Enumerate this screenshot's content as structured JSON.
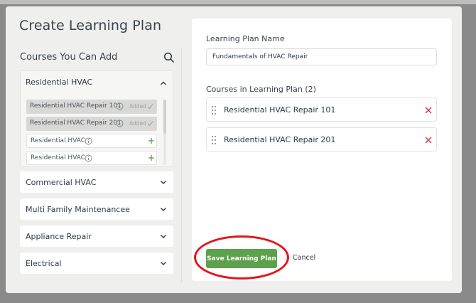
{
  "modal": {
    "title": "Create Learning Plan",
    "left_heading": "Courses You Can Add"
  },
  "course_groups": [
    {
      "label": "Residential HVAC",
      "expanded": true,
      "courses": [
        {
          "name": "Residential HVAC Repair 101",
          "status": "Added"
        },
        {
          "name": "Residential HVAC Repair 201",
          "status": "Added"
        },
        {
          "name": "Residential HVAC",
          "status": "available"
        },
        {
          "name": "Residential HVAC",
          "status": "available"
        }
      ]
    },
    {
      "label": "Commercial HVAC",
      "expanded": false
    },
    {
      "label": "Multi Family Maintenancee",
      "expanded": false
    },
    {
      "label": "Appliance Repair",
      "expanded": false
    },
    {
      "label": "Electrical",
      "expanded": false
    }
  ],
  "plan": {
    "name_label": "Learning Plan Name",
    "name_value": "Fundamentals of HVAC Repair",
    "courses_label": "Courses in Learning Plan (2)",
    "courses": [
      {
        "name": "Residential HVAC Repair 101"
      },
      {
        "name": "Residential HVAC Repair 201"
      }
    ]
  },
  "actions": {
    "save_label": "Save Learning Plan",
    "cancel_label": "Cancel"
  },
  "colors": {
    "primary_button": "#5ea14c",
    "remove_icon": "#d9343a",
    "add_icon": "#5ea14c",
    "highlight_ring": "#e0161c"
  }
}
